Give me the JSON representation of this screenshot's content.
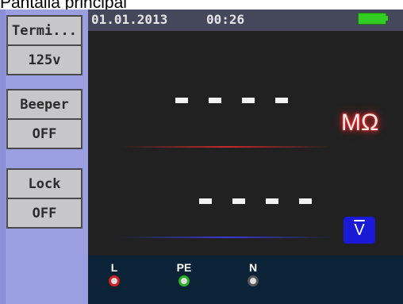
{
  "caption": "Pantalla principal",
  "status": {
    "date": "01.01.2013",
    "time": "00:26"
  },
  "icons": {
    "battery": "battery-full-icon"
  },
  "left_menu": [
    {
      "line1": "Termi...",
      "line2": "125v"
    },
    {
      "line1": "Beeper",
      "line2": "OFF"
    },
    {
      "line1": "Lock",
      "line2": "OFF"
    }
  ],
  "resistance": {
    "reading": "- - - -",
    "unit": "MΩ"
  },
  "voltage": {
    "reading": "- - - -",
    "unit_symbol": "V"
  },
  "terminals": [
    {
      "label": "L",
      "color": "#d62020"
    },
    {
      "label": "PE",
      "color": "#28b028"
    },
    {
      "label": "N",
      "color": "#9a9a9a"
    }
  ],
  "colors": {
    "resistance_glow": "#ff2a2a",
    "voltage_badge": "#1a1ad6",
    "battery": "#33cc22"
  }
}
